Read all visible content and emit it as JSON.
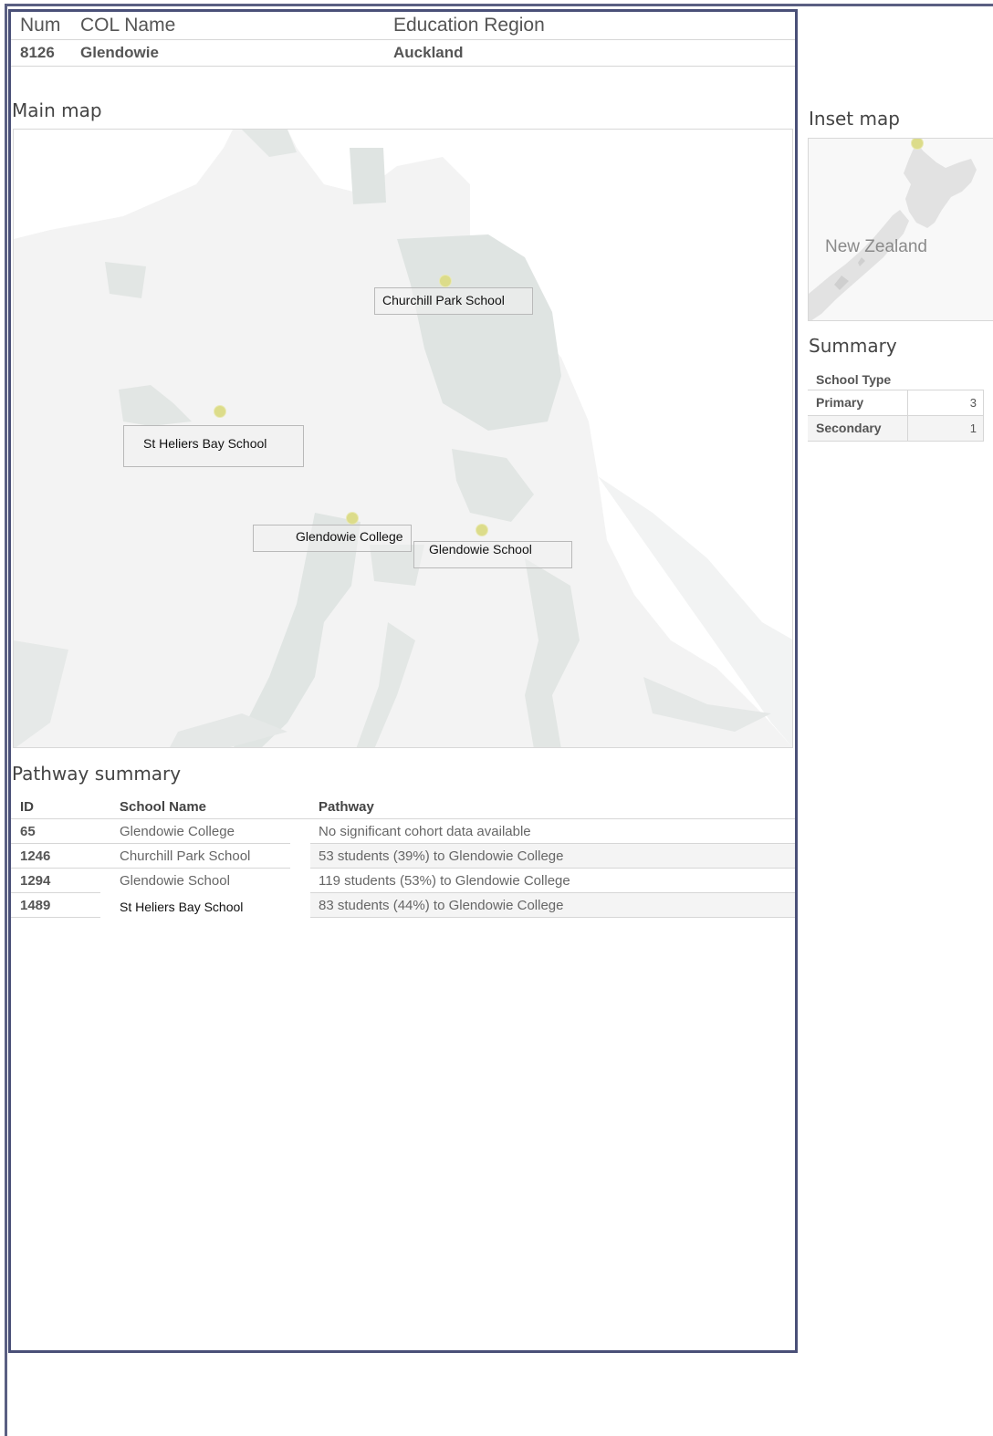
{
  "header": {
    "columns": {
      "num": "Num",
      "col_name": "COL Name",
      "region": "Education Region"
    },
    "row": {
      "num": "8126",
      "col_name": "Glendowie",
      "region": "Auckland"
    }
  },
  "main_map": {
    "title": "Main map",
    "schools": [
      {
        "name": "Churchill Park School"
      },
      {
        "name": "St Heliers Bay School"
      },
      {
        "name": "Glendowie College"
      },
      {
        "name": "Glendowie School"
      }
    ]
  },
  "pathway_summary": {
    "title": "Pathway summary",
    "columns": {
      "id": "ID",
      "school_name": "School Name",
      "pathway": "Pathway"
    },
    "rows": [
      {
        "id": "65",
        "school_name": "Glendowie College",
        "pathway": "No significant cohort data available"
      },
      {
        "id": "1246",
        "school_name": "Churchill Park School",
        "pathway": "53 students (39%) to Glendowie College"
      },
      {
        "id": "1294",
        "school_name": "Glendowie School",
        "pathway": "119 students (53%) to Glendowie College"
      },
      {
        "id": "1489",
        "school_name": "St Heliers Bay School",
        "pathway": "83 students (44%) to Glendowie College"
      }
    ]
  },
  "inset_map": {
    "title": "Inset map",
    "label": "New Zealand"
  },
  "summary": {
    "title": "Summary",
    "column": "School Type",
    "rows": [
      {
        "type": "Primary",
        "count": "3"
      },
      {
        "type": "Secondary",
        "count": "1"
      }
    ]
  },
  "colors": {
    "frame": "#4a5078",
    "marker": "#dcdc8a",
    "land": "#eeefef",
    "park": "#dfe4e2"
  }
}
